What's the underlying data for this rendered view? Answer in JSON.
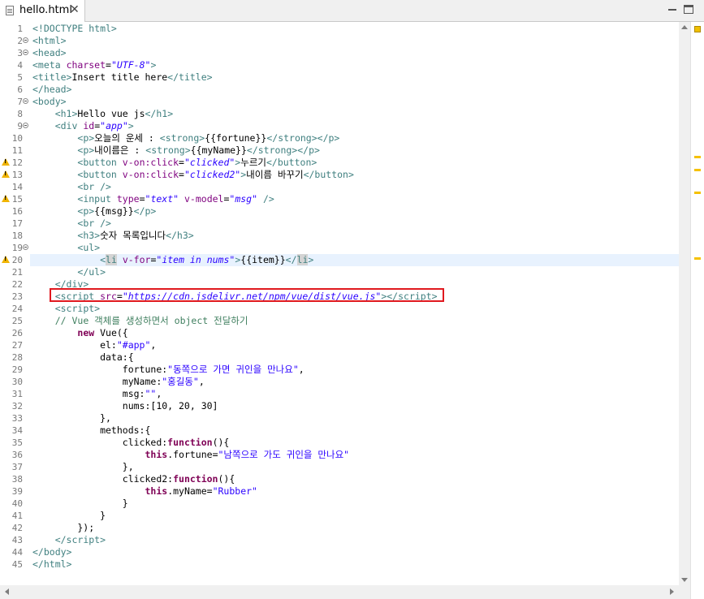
{
  "tab": {
    "title": "hello.html",
    "close": "✕"
  },
  "lines": [
    {
      "n": "1",
      "fold": false,
      "warn": false,
      "html": "<span class='t'>&lt;!DOCTYPE html&gt;</span>"
    },
    {
      "n": "2",
      "fold": true,
      "warn": false,
      "html": "<span class='t'>&lt;html&gt;</span>"
    },
    {
      "n": "3",
      "fold": true,
      "warn": false,
      "html": "<span class='t'>&lt;head&gt;</span>"
    },
    {
      "n": "4",
      "fold": false,
      "warn": false,
      "html": "<span class='t'>&lt;meta</span> <span class='a'>charset</span>=<span class='v'>\"UTF-8\"</span><span class='t'>&gt;</span>"
    },
    {
      "n": "5",
      "fold": false,
      "warn": false,
      "html": "<span class='t'>&lt;title&gt;</span><span class='txt'>Insert title here</span><span class='t'>&lt;/title&gt;</span>"
    },
    {
      "n": "6",
      "fold": false,
      "warn": false,
      "html": "<span class='t'>&lt;/head&gt;</span>"
    },
    {
      "n": "7",
      "fold": true,
      "warn": false,
      "html": "<span class='t'>&lt;body&gt;</span>"
    },
    {
      "n": "8",
      "fold": false,
      "warn": false,
      "html": "    <span class='t'>&lt;h1&gt;</span><span class='txt'>Hello vue js</span><span class='t'>&lt;/h1&gt;</span>"
    },
    {
      "n": "9",
      "fold": true,
      "warn": false,
      "html": "    <span class='t'>&lt;div</span> <span class='a'>id</span>=<span class='v'>\"app\"</span><span class='t'>&gt;</span>"
    },
    {
      "n": "10",
      "fold": false,
      "warn": false,
      "html": "        <span class='t'>&lt;p&gt;</span><span class='txt'>오늘의 운세 : </span><span class='t'>&lt;strong&gt;</span><span class='txt'>{{fortune}}</span><span class='t'>&lt;/strong&gt;&lt;/p&gt;</span>"
    },
    {
      "n": "11",
      "fold": false,
      "warn": false,
      "html": "        <span class='t'>&lt;p&gt;</span><span class='txt'>내이름은 : </span><span class='t'>&lt;strong&gt;</span><span class='txt'>{{myName}}</span><span class='t'>&lt;/strong&gt;&lt;/p&gt;</span>"
    },
    {
      "n": "12",
      "fold": false,
      "warn": true,
      "html": "        <span class='t'>&lt;button</span> <span class='a'>v-on:click</span>=<span class='v'>\"clicked\"</span><span class='t'>&gt;</span><span class='txt'>누르기</span><span class='t'>&lt;/button&gt;</span>"
    },
    {
      "n": "13",
      "fold": false,
      "warn": true,
      "html": "        <span class='t'>&lt;button</span> <span class='a'>v-on:click</span>=<span class='v'>\"clicked2\"</span><span class='t'>&gt;</span><span class='txt'>내이름 바꾸기</span><span class='t'>&lt;/button&gt;</span>"
    },
    {
      "n": "14",
      "fold": false,
      "warn": false,
      "html": "        <span class='t'>&lt;br /&gt;</span>"
    },
    {
      "n": "15",
      "fold": false,
      "warn": true,
      "html": "        <span class='t'>&lt;input</span> <span class='a'>type</span>=<span class='v'>\"text\"</span> <span class='a'>v-model</span>=<span class='v'>\"msg\"</span> <span class='t'>/&gt;</span>"
    },
    {
      "n": "16",
      "fold": false,
      "warn": false,
      "html": "        <span class='t'>&lt;p&gt;</span><span class='txt'>{{msg}}</span><span class='t'>&lt;/p&gt;</span>"
    },
    {
      "n": "17",
      "fold": false,
      "warn": false,
      "html": "        <span class='t'>&lt;br /&gt;</span>"
    },
    {
      "n": "18",
      "fold": false,
      "warn": false,
      "html": "        <span class='t'>&lt;h3&gt;</span><span class='txt'>숫자 목록입니다</span><span class='t'>&lt;/h3&gt;</span>"
    },
    {
      "n": "19",
      "fold": true,
      "warn": false,
      "html": "        <span class='t'>&lt;ul&gt;</span>"
    },
    {
      "n": "20",
      "fold": false,
      "warn": true,
      "cur": true,
      "html": "            <span class='t'>&lt;<span class='hl'>li</span></span> <span class='a'>v-for</span>=<span class='v'>\"item in nums\"</span><span class='t'>&gt;</span><span class='txt'>{{item}}</span><span class='t'>&lt;/<span class='hl'>li</span>&gt;</span>"
    },
    {
      "n": "21",
      "fold": false,
      "warn": false,
      "html": "        <span class='t'>&lt;/ul&gt;</span>"
    },
    {
      "n": "22",
      "fold": false,
      "warn": false,
      "html": "    <span class='t'>&lt;/div&gt;</span>"
    },
    {
      "n": "23",
      "fold": false,
      "warn": false,
      "html": "    <span class='t'>&lt;script</span> <span class='a'>src</span>=<span class='v'>\"https://cdn.jsdelivr.net/npm/vue/dist/vue.js\"</span><span class='t'>&gt;&lt;/script&gt;</span>"
    },
    {
      "n": "24",
      "fold": false,
      "warn": false,
      "html": "    <span class='t'>&lt;script&gt;</span>"
    },
    {
      "n": "25",
      "fold": false,
      "warn": false,
      "html": "    <span class='c'>// Vue 객체를 생성하면서 object 전달하기</span>"
    },
    {
      "n": "26",
      "fold": false,
      "warn": false,
      "html": "        <span class='k'>new</span> Vue({"
    },
    {
      "n": "27",
      "fold": false,
      "warn": false,
      "html": "            el:<span class='s'>\"#app\"</span>,"
    },
    {
      "n": "28",
      "fold": false,
      "warn": false,
      "html": "            data:{"
    },
    {
      "n": "29",
      "fold": false,
      "warn": false,
      "html": "                fortune:<span class='s'>\"동쪽으로 가면 귀인을 만나요\"</span>,"
    },
    {
      "n": "30",
      "fold": false,
      "warn": false,
      "html": "                myName:<span class='s'>\"홍길동\"</span>,"
    },
    {
      "n": "31",
      "fold": false,
      "warn": false,
      "html": "                msg:<span class='s'>\"\"</span>,"
    },
    {
      "n": "32",
      "fold": false,
      "warn": false,
      "html": "                nums:[10, 20, 30]"
    },
    {
      "n": "33",
      "fold": false,
      "warn": false,
      "html": "            },"
    },
    {
      "n": "34",
      "fold": false,
      "warn": false,
      "html": "            methods:{"
    },
    {
      "n": "35",
      "fold": false,
      "warn": false,
      "html": "                clicked:<span class='k'>function</span>(){"
    },
    {
      "n": "36",
      "fold": false,
      "warn": false,
      "html": "                    <span class='k'>this</span>.fortune=<span class='s'>\"남쪽으로 가도 귀인을 만나요\"</span>"
    },
    {
      "n": "37",
      "fold": false,
      "warn": false,
      "html": "                },"
    },
    {
      "n": "38",
      "fold": false,
      "warn": false,
      "html": "                clicked2:<span class='k'>function</span>(){"
    },
    {
      "n": "39",
      "fold": false,
      "warn": false,
      "html": "                    <span class='k'>this</span>.myName=<span class='s'>\"Rubber\"</span>"
    },
    {
      "n": "40",
      "fold": false,
      "warn": false,
      "html": "                }"
    },
    {
      "n": "41",
      "fold": false,
      "warn": false,
      "html": "            }"
    },
    {
      "n": "42",
      "fold": false,
      "warn": false,
      "html": "        });"
    },
    {
      "n": "43",
      "fold": false,
      "warn": false,
      "html": "    <span class='t'>&lt;/script&gt;</span>"
    },
    {
      "n": "44",
      "fold": false,
      "warn": false,
      "html": "<span class='t'>&lt;/body&gt;</span>"
    },
    {
      "n": "45",
      "fold": false,
      "warn": false,
      "html": "<span class='t'>&lt;/html&gt;</span>"
    }
  ],
  "colors": {
    "tag": "#3f7f7f",
    "attr": "#7f007f",
    "value": "#2a00ff",
    "keyword": "#7f0055",
    "comment": "#3f7f5f",
    "highlight_box": "#e0191f"
  },
  "icons": {
    "file": "html-file-icon",
    "close": "close-icon",
    "warning": "warning-icon",
    "fold": "fold-toggle-icon"
  }
}
